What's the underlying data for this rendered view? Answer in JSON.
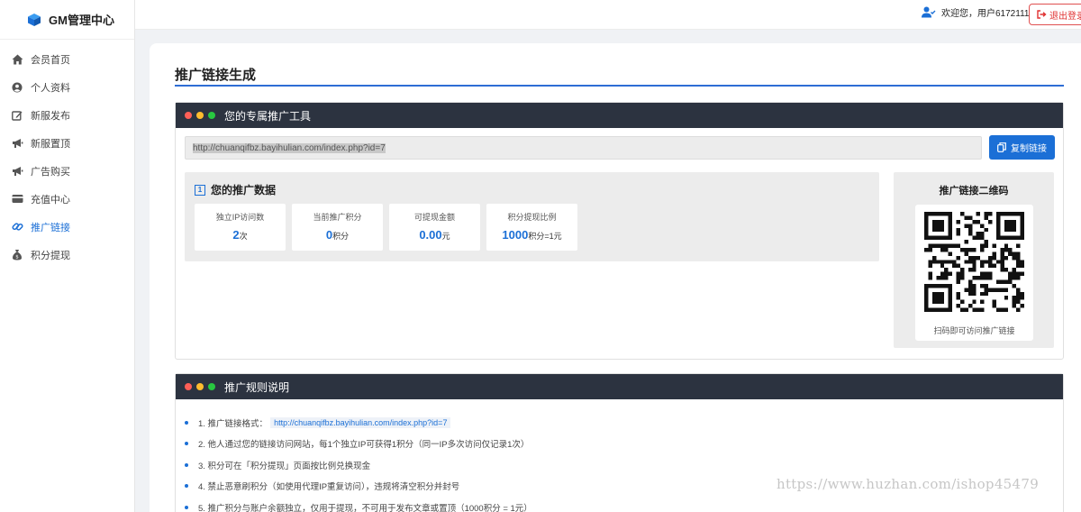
{
  "app": {
    "name": "GM管理中心"
  },
  "sidebar": {
    "items": [
      {
        "label": "会员首页",
        "icon": "home-icon",
        "active": false
      },
      {
        "label": "个人资料",
        "icon": "user-circle-icon",
        "active": false
      },
      {
        "label": "新服发布",
        "icon": "edit-icon",
        "active": false
      },
      {
        "label": "新服置顶",
        "icon": "megaphone-icon",
        "active": false
      },
      {
        "label": "广告购买",
        "icon": "megaphone-icon",
        "active": false
      },
      {
        "label": "充值中心",
        "icon": "credit-card-icon",
        "active": false
      },
      {
        "label": "推广链接",
        "icon": "link-icon",
        "active": true
      },
      {
        "label": "积分提现",
        "icon": "money-bag-icon",
        "active": false
      }
    ]
  },
  "header": {
    "welcome": "欢迎您，用户6172111",
    "logout_label": "退出登录"
  },
  "page": {
    "title": "推广链接生成"
  },
  "tool_panel": {
    "title": "您的专属推广工具",
    "link": "http://chuanqifbz.bayihulian.com/index.php?id=7",
    "copy_label": "复制链接",
    "stats_title": "您的推广数据",
    "stats": [
      {
        "label": "独立IP访问数",
        "value": "2",
        "unit": "次"
      },
      {
        "label": "当前推广积分",
        "value": "0",
        "unit": "积分"
      },
      {
        "label": "可提现金额",
        "value": "0.00",
        "unit": "元"
      },
      {
        "label": "积分提现比例",
        "value": "1000",
        "unit": "积分=1元"
      }
    ],
    "qr_title": "推广链接二维码",
    "qr_caption": "扫码即可访问推广链接"
  },
  "rules_panel": {
    "title": "推广规则说明",
    "rule1_prefix": "1. 推广链接格式：",
    "rule1_link": "http://chuanqifbz.bayihulian.com/index.php?id=7",
    "rules": [
      "2. 他人通过您的链接访问网站，每1个独立IP可获得1积分（同一IP多次访问仅记录1次）",
      "3. 积分可在「积分提现」页面按比例兑换现金",
      "4. 禁止恶意刷积分（如使用代理IP重复访问），违规将清空积分并封号",
      "5. 推广积分与账户余额独立，仅用于提现，不可用于发布文章或置顶（1000积分 = 1元）"
    ]
  },
  "watermark": "https://www.huzhan.com/ishop45479",
  "colors": {
    "accent": "#1b6fd6",
    "panel_header": "#2c3340",
    "danger": "#e03030"
  }
}
